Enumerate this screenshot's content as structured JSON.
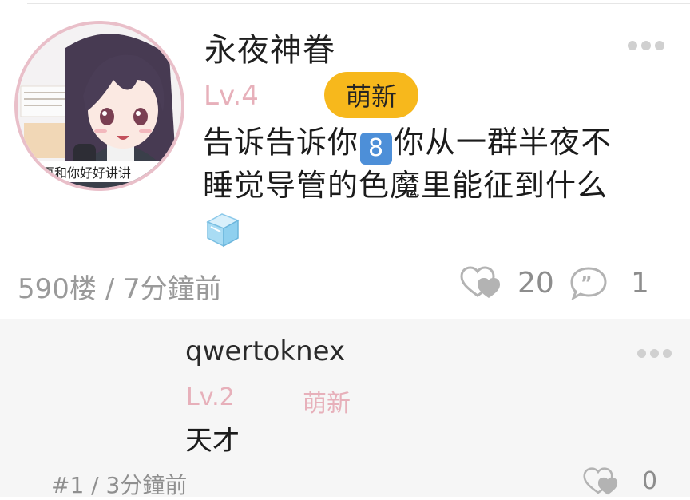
{
  "post": {
    "username": "永夜神眷",
    "level": "Lv.4",
    "badge": "萌新",
    "content_line_1_prefix": "告诉告诉你",
    "keycap": "8",
    "content_line_1_suffix": "你从一群半夜不",
    "content_line_2": "睡觉导管的色魔里能征到什么",
    "avatar_sign_text": "再和你好好讲讲",
    "meta": "590楼 / 7分鐘前",
    "likes": "20",
    "comments": "1"
  },
  "reply": {
    "username": "qwertoknex",
    "level": "Lv.2",
    "badge": "萌新",
    "content": "天才",
    "meta": "#1 / 3分鐘前",
    "likes": "0"
  },
  "colors": {
    "badge_bg": "#f7b81c",
    "level_pink": "#e7b0ba",
    "avatar_border": "#e9bfc9",
    "reply_bg": "#f6f6f6"
  },
  "icons": [
    "more-icon",
    "like-icon",
    "comment-icon",
    "ice-cube-emoji",
    "keycap-8-emoji"
  ]
}
